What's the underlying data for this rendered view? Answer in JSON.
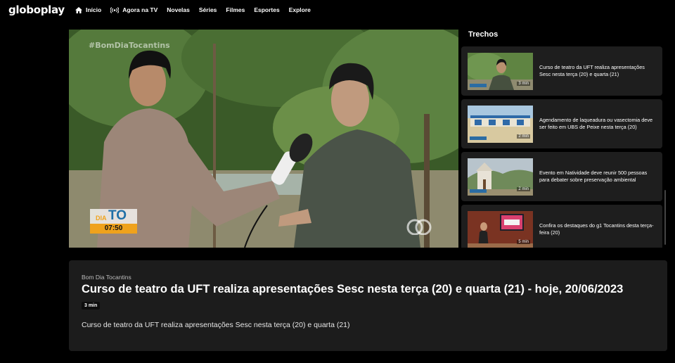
{
  "brand": {
    "logo_text": "globoplay"
  },
  "nav": {
    "items": [
      {
        "label": "Início",
        "icon": "home-icon"
      },
      {
        "label": "Agora na TV",
        "icon": "live-broadcast-icon"
      },
      {
        "label": "Novelas"
      },
      {
        "label": "Séries"
      },
      {
        "label": "Filmes"
      },
      {
        "label": "Esportes"
      },
      {
        "label": "Explore"
      }
    ]
  },
  "player": {
    "hashtag": "#BomDiaTocantins",
    "bug": {
      "dia": "DIA",
      "to": "TO",
      "time": "07:50"
    }
  },
  "trechos": {
    "heading": "Trechos",
    "items": [
      {
        "title": "Curso de teatro da UFT realiza apresentações Sesc nesta terça (20) e quarta (21)",
        "duration": "3 min"
      },
      {
        "title": "Agendamento de laqueadura ou vasectomia deve ser feito em UBS de Peixe nesta terça (20)",
        "duration": "2 min"
      },
      {
        "title": "Evento em Natividade deve reunir 500 pessoas para debater sobre preservação ambiental",
        "duration": "2 min"
      },
      {
        "title": "Confira os destaques do g1 Tocantins desta terça-feira (20)",
        "duration": "5 min"
      }
    ]
  },
  "info": {
    "program": "Bom Dia Tocantins",
    "title": "Curso de teatro da UFT realiza apresentações Sesc nesta terça (20) e quarta (21) - hoje, 20/06/2023",
    "duration": "3 min",
    "description": "Curso de teatro da UFT realiza apresentações Sesc nesta terça (20) e quarta (21)"
  },
  "colors": {
    "background": "#000000",
    "card": "#1e1e1e",
    "panel": "#1c1c1c",
    "bug_orange": "#efa21d",
    "bug_blue": "#1f6fa7"
  }
}
